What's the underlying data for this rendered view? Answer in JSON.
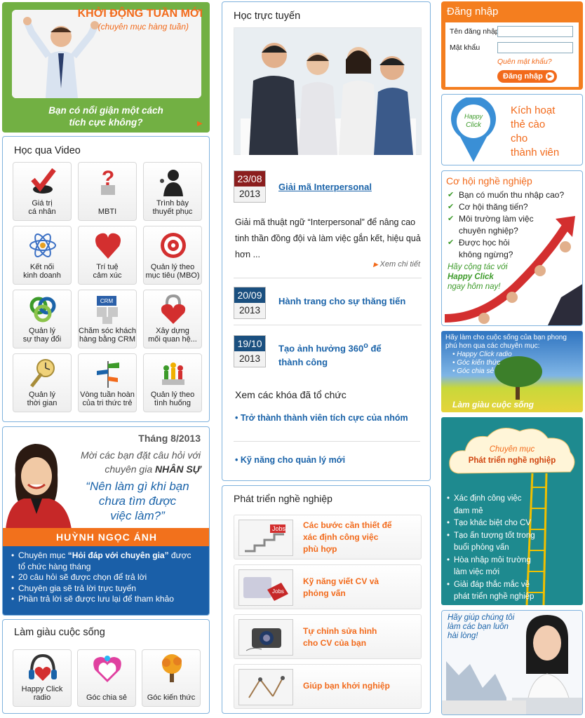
{
  "banner": {
    "title": "KHỞI ĐỘNG TUẦN MỚI",
    "subtitle": "(chuyên mục hàng tuần)",
    "question_line1": "Bạn có nổi giận một cách",
    "question_line2": "tích cực không?"
  },
  "video": {
    "title": "Học qua Video",
    "tiles": [
      {
        "l1": "Giá trị",
        "l2": "cá nhân"
      },
      {
        "l1": "",
        "l2": "MBTI"
      },
      {
        "l1": "Trình bày",
        "l2": "thuyết phục"
      },
      {
        "l1": "Kết nối",
        "l2": "kinh doanh"
      },
      {
        "l1": "Trí tuệ",
        "l2": "cảm xúc"
      },
      {
        "l1": "Quản lý theo",
        "l2": "mục tiêu (MBO)"
      },
      {
        "l1": "Quản lý",
        "l2": "sự thay đổi"
      },
      {
        "l1": "Chăm sóc khách",
        "l2": "hàng bằng CRM",
        "crm": "CRM"
      },
      {
        "l1": "Xây dựng",
        "l2": "mối quan hệ..."
      },
      {
        "l1": "Quản lý",
        "l2": "thời gian"
      },
      {
        "l1": "Vòng tuần hoàn",
        "l2": "của tri thức trẻ"
      },
      {
        "l1": "Quản lý theo",
        "l2": "tình huống"
      }
    ]
  },
  "expert": {
    "month": "Tháng 8/2013",
    "invite1": "Mời các bạn đặt câu hỏi với",
    "invite2a": "chuyên gia ",
    "invite2b": "NHÂN SỰ",
    "q1": "“Nên làm gì khi bạn",
    "q2": "chưa tìm được",
    "q3": "việc làm?”",
    "name": "HUỲNH NGỌC ÁNH",
    "list": {
      "l1a": "Chuyên mục ",
      "l1b": "“Hỏi đáp với chuyên gia”",
      "l1c": " được",
      "l1d": "tổ chức hàng tháng",
      "l2": "20 câu hỏi sẽ được chọn để trả lời",
      "l3": "Chuyên gia sẽ trả lời trực tuyến",
      "l4": "Phần trả lời sẽ được lưu lại để tham khảo"
    }
  },
  "lamgiau": {
    "title": "Làm giàu cuộc sống",
    "tiles": [
      {
        "l1": "Happy Click",
        "l2": "radio"
      },
      {
        "l1": "",
        "l2": "Góc chia sẻ"
      },
      {
        "l1": "",
        "l2": "Góc kiến thức"
      }
    ]
  },
  "online": {
    "title": "Học trực tuyến",
    "featured": {
      "day": "23/08",
      "year": "2013",
      "title": "Giải mã Interpersonal",
      "desc1": "Giải mã thuật ngữ “Interpersonal” để nâng cao",
      "desc2": "tinh thần đồng đội và làm việc gắn kết, hiệu quả",
      "desc3": "hơn ...",
      "more": "Xem chi tiết"
    },
    "items": [
      {
        "day": "20/09",
        "year": "2013",
        "t1": "Hành trang cho sự thăng tiến",
        "t2": ""
      },
      {
        "day": "19/10",
        "year": "2013",
        "t1": "Tạo ảnh hưởng 360",
        "sup": "o",
        "t1b": " để",
        "t2": "thành công"
      }
    ],
    "past_title": "Xem các khóa đã tổ chức",
    "past": [
      "Trở thành thành viên tích cực của nhóm",
      "Kỹ năng cho quản lý mới"
    ]
  },
  "career_dev": {
    "title": "Phát triển nghề nghiệp",
    "items": [
      {
        "l1": "Các bước cần thiết để",
        "l2": "xác định công việc",
        "l3": "phù hợp"
      },
      {
        "l1": "Kỹ năng viết CV và",
        "l2": "phỏng vấn",
        "l3": ""
      },
      {
        "l1": "Tự chỉnh sửa hình",
        "l2": "cho CV của bạn",
        "l3": ""
      },
      {
        "l1": "Giúp bạn khởi nghiệp",
        "l2": "",
        "l3": ""
      }
    ]
  },
  "login": {
    "title": "Đăng nhập",
    "user_label": "Tên đăng nhập",
    "pass_label": "Mật khẩu",
    "forgot": "Quên mật khẩu?",
    "button": "Đăng nhập"
  },
  "activate": {
    "pin1": "Happy",
    "pin2": "Click",
    "l1": "Kích hoạt",
    "l2": "thẻ cào",
    "l3": "cho",
    "l4": "thành viên"
  },
  "opportunity": {
    "title": "Cơ hội nghề nghiệp",
    "items": [
      "Bạn có muốn thu nhập cao?",
      "Cơ hội thăng tiến?",
      "Môi trường làm việc",
      "chuyên nghiệp?",
      "Được học hỏi",
      "không ngừng?"
    ],
    "cta1": "Hãy cộng tác với",
    "cta2": "Happy Click",
    "cta3": "ngay hôm nay!"
  },
  "life": {
    "l1": "Hãy làm cho cuộc sống của bạn phong",
    "l2": "phú hơn qua các chuyên mục:",
    "items": [
      "Happy Click radio",
      "Góc kiến thức",
      "Góc chia sẻ"
    ],
    "caption": "Làm giàu cuộc sống"
  },
  "career_col": {
    "c1": "Chuyên mục",
    "c2": "Phát triển nghề nghiệp",
    "items": [
      "Xác định công việc",
      "đam mê",
      "Tạo khác biệt cho CV",
      "Tạo ấn tượng tốt trong",
      "buổi phỏng vấn",
      "Hòa nhập môi trường",
      "làm việc mới",
      "Giải đáp thắc mắc về",
      "phát triển nghề nghiệp"
    ]
  },
  "support": {
    "l1": "Hãy giúp chúng tôi",
    "l2": "làm các bạn luôn",
    "l3": "hài lòng!"
  },
  "colors": {
    "orange": "#f26a1b",
    "green": "#72b043",
    "blue": "#1a63a9",
    "border": "#7fb2dd"
  }
}
